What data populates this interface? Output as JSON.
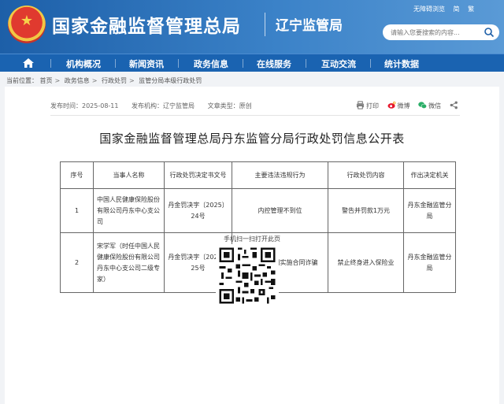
{
  "header": {
    "site_title": "国家金融监督管理总局",
    "sub_title": "辽宁监管局",
    "top_links": [
      "无障碍浏览",
      "简",
      "繁"
    ],
    "search_placeholder": "请输入您要搜索的内容...",
    "emblem_icon": "national-emblem-icon",
    "brand_color": "#1d5fa8"
  },
  "nav": {
    "home_icon": "home-icon",
    "items": [
      "机构概况",
      "新闻资讯",
      "政务信息",
      "在线服务",
      "互动交流",
      "统计数据"
    ]
  },
  "breadcrumb": {
    "label": "当前位置：",
    "items": [
      "首页",
      "政务信息",
      "行政处罚",
      "监管分局本级行政处罚"
    ]
  },
  "article": {
    "published": "发布时间：2025-08-11",
    "source": "发布机构：辽宁监管局",
    "origin": "文章类型：原创",
    "share": [
      {
        "label": "打印",
        "icon": "print-icon"
      },
      {
        "label": "微博",
        "icon": "weibo-icon"
      },
      {
        "label": "微信",
        "icon": "wechat-icon"
      },
      {
        "label": "",
        "icon": "share-icon"
      }
    ],
    "title": "国家金融监督管理总局丹东监管分局行政处罚信息公开表"
  },
  "table": {
    "headers": [
      "序号",
      "当事人名称",
      "行政处罚决定书文号",
      "主要违法违规行为",
      "行政处罚内容",
      "作出决定机关"
    ],
    "rows": [
      {
        "no": "1",
        "party": "中国人民健康保险股份有限公司丹东中心支公司",
        "doc_no": "丹金罚决字〔2025〕24号",
        "violation": "内控管理不到位",
        "penalty": "警告并罚款1万元",
        "authority": "丹东金融监管分局"
      },
      {
        "no": "2",
        "party": "宋学军（时任中国人民健康保险股份有限公司丹东中心支公司二级专家）",
        "doc_no": "丹金罚决字〔2025〕25号",
        "violation": "保险从业期间实施合同诈骗",
        "penalty": "禁止终身进入保险业",
        "authority": "丹东金融监管分局"
      }
    ]
  },
  "qr": {
    "caption": "手机扫一扫打开此页",
    "icon": "qr-code-icon"
  }
}
